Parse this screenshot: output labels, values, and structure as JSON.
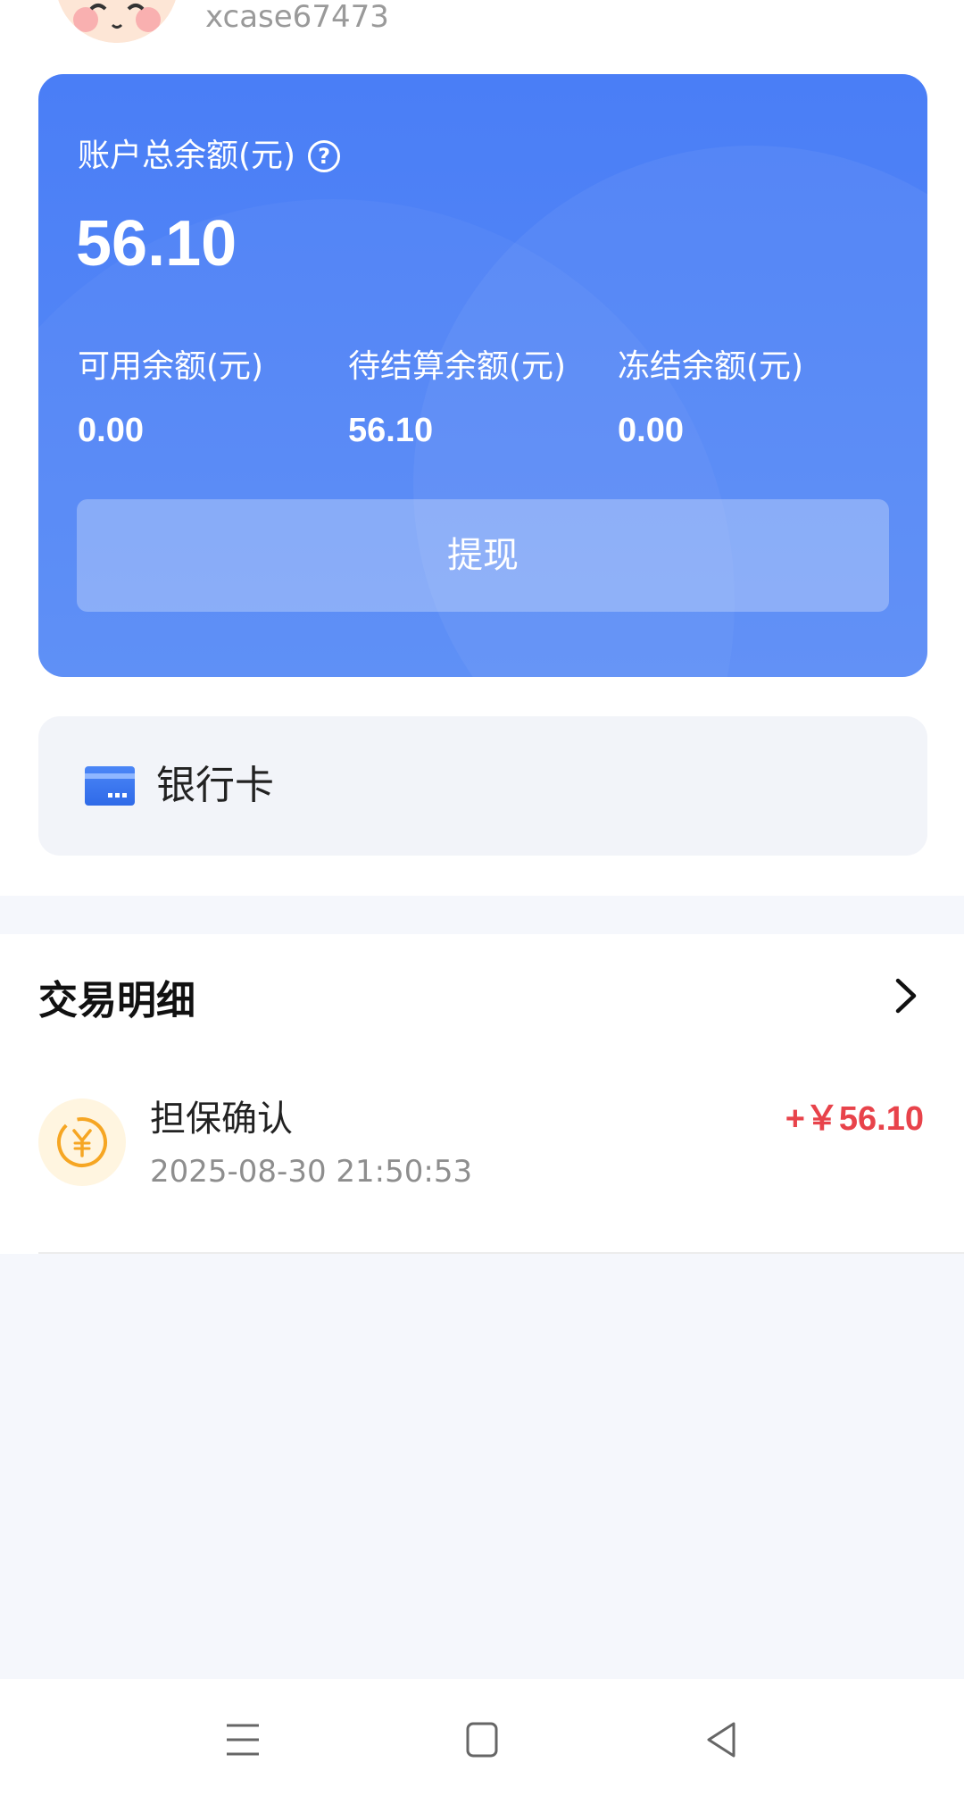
{
  "profile": {
    "username": "xcase67473"
  },
  "balance_card": {
    "total_label": "账户总余额(元)",
    "total_value": "56.10",
    "help_icon": "question-circle",
    "available_label": "可用余额(元)",
    "available_value": "0.00",
    "pending_label": "待结算余额(元)",
    "pending_value": "56.10",
    "frozen_label": "冻结余额(元)",
    "frozen_value": "0.00",
    "withdraw_label": "提现",
    "color": "#4a7ef6"
  },
  "bank_card": {
    "label": "银行卡",
    "icon": "bank-card-icon"
  },
  "transactions": {
    "title": "交易明细",
    "items": [
      {
        "title": "担保确认",
        "time": "2025-08-30 21:50:53",
        "amount": "+￥56.10",
        "amount_color": "#e8434b",
        "icon": "yuan-coin-icon"
      }
    ]
  },
  "nav_bar": {
    "buttons": [
      "menu",
      "home",
      "back"
    ]
  }
}
